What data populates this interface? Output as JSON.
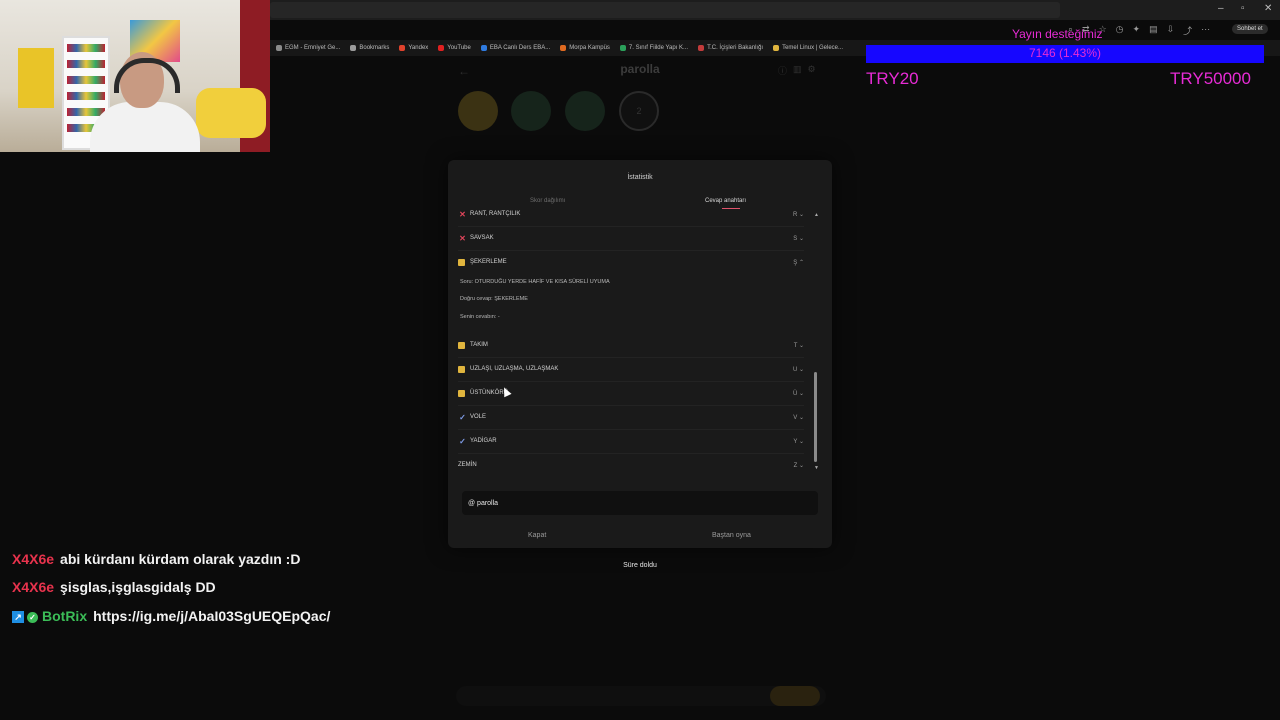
{
  "browser": {
    "bookmarks": [
      {
        "label": "EGM - Emniyet Ge...",
        "color": "#8a8a8a"
      },
      {
        "label": "Bookmarks",
        "color": "#9a9a9a"
      },
      {
        "label": "Yandex",
        "color": "#e0422c"
      },
      {
        "label": "YouTube",
        "color": "#e02020"
      },
      {
        "label": "EBA Canlı Ders EBA...",
        "color": "#2f7be0"
      },
      {
        "label": "Morpa Kampüs",
        "color": "#e06a20"
      },
      {
        "label": "7. Sınıf Fiilde Yapı K...",
        "color": "#2ba05a"
      },
      {
        "label": "T.C. İçişleri Bakanlığı",
        "color": "#c23b3b"
      },
      {
        "label": "Temel Linux | Gelece...",
        "color": "#e0b53e"
      }
    ],
    "chat_button_label": "Sohbet et"
  },
  "game": {
    "title": "parolla",
    "center_circle_label": "2"
  },
  "modal": {
    "title": "İstatistik",
    "tabs": {
      "score": "Skor dağılımı",
      "answers": "Cevap anahtarı"
    },
    "rows": [
      {
        "word": "RANT, RANTÇILIK",
        "status": "wrong",
        "letter": "R"
      },
      {
        "word": "SAVSAK",
        "status": "wrong",
        "letter": "S"
      },
      {
        "word": "ŞEKERLEME",
        "status": "pass",
        "letter": "Ş"
      },
      {
        "word": "TAKIM",
        "status": "pass",
        "letter": "T"
      },
      {
        "word": "UZLAŞI, UZLAŞMA, UZLAŞMAK",
        "status": "pass",
        "letter": "U"
      },
      {
        "word": "ÜSTÜNKÖRÜ",
        "status": "pass",
        "letter": "Ü"
      },
      {
        "word": "VOLE",
        "status": "correct",
        "letter": "V"
      },
      {
        "word": "YADİGAR",
        "status": "correct",
        "letter": "Y"
      },
      {
        "word": "ZEMİN",
        "status": "none",
        "letter": "Z"
      }
    ],
    "expanded": {
      "question": "Soru: OTURDUĞU YERDE HAFİF VE KISA SÜRELİ UYUMA",
      "correct": "Doğru cevap: ŞEKERLEME",
      "yours": "Senin cevabın: -"
    },
    "share_text": "@ parolla",
    "close_label": "Kapat",
    "replay_label": "Baştan oyna"
  },
  "time_up_label": "Süre doldu",
  "donation": {
    "title": "Yayın desteğimiz",
    "progress": "7146 (1.43%)",
    "progress_fraction": 0.0143,
    "min": "TRY20",
    "max": "TRY50000",
    "bar_color": "#1607ff",
    "text_color": "#e72bd5"
  },
  "chat": [
    {
      "user": "X4X6e",
      "color": "#e8334d",
      "text": "abi kürdanı kürdam olarak yazdın :D"
    },
    {
      "user": "X4X6e",
      "color": "#e8334d",
      "text": "şisglas,işglasgidalş DD"
    },
    {
      "user": "BotRix",
      "color": "#3bbd57",
      "text": "https://ig.me/j/AbaI03SgUEQEpQac/"
    }
  ]
}
